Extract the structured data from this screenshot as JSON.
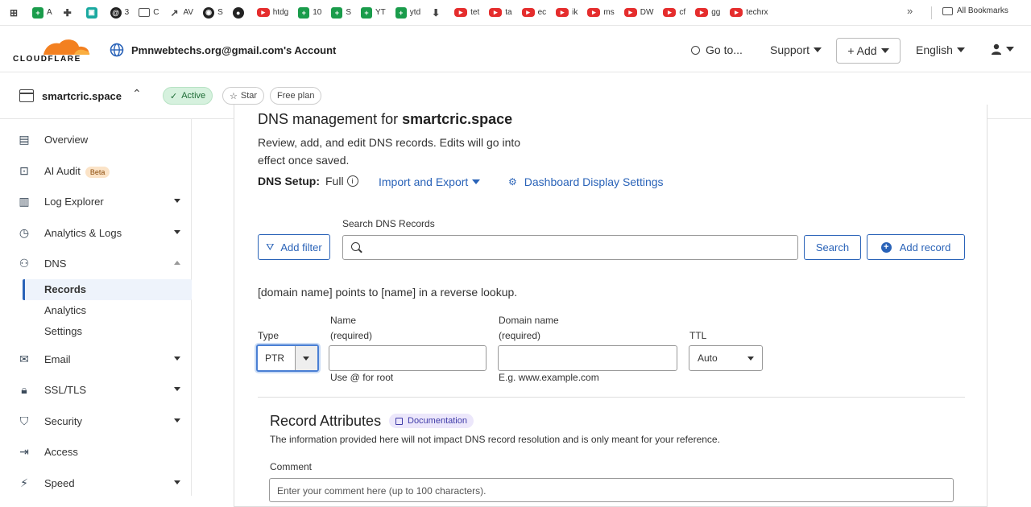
{
  "bookmarks": {
    "items": [
      {
        "label": "",
        "icon": "grid-icon"
      },
      {
        "label": "A",
        "icon": "sheets-icon"
      },
      {
        "label": "",
        "icon": "extension-icon"
      },
      {
        "label": "",
        "icon": "teal-square-icon"
      },
      {
        "label": "3",
        "icon": "threads-icon"
      },
      {
        "label": "C",
        "icon": "folder-icon"
      },
      {
        "label": "AV",
        "icon": "chart-icon"
      },
      {
        "label": "S",
        "icon": "chrome-icon"
      },
      {
        "label": "",
        "icon": "github-icon"
      },
      {
        "label": "htdg",
        "icon": "youtube-icon"
      },
      {
        "label": "10",
        "icon": "sheets-icon"
      },
      {
        "label": "S",
        "icon": "sheets-icon"
      },
      {
        "label": "YT",
        "icon": "sheets-icon"
      },
      {
        "label": "ytd",
        "icon": "sheets-icon"
      },
      {
        "label": "",
        "icon": "pin-icon"
      },
      {
        "label": "tet",
        "icon": "youtube-icon"
      },
      {
        "label": "ta",
        "icon": "youtube-icon"
      },
      {
        "label": "ec",
        "icon": "youtube-icon"
      },
      {
        "label": "ik",
        "icon": "youtube-icon"
      },
      {
        "label": "ms",
        "icon": "youtube-icon"
      },
      {
        "label": "DW",
        "icon": "youtube-icon"
      },
      {
        "label": "cf",
        "icon": "youtube-icon"
      },
      {
        "label": "gg",
        "icon": "youtube-icon"
      },
      {
        "label": "techrx",
        "icon": "youtube-icon"
      }
    ],
    "more": "»",
    "all_label": "All Bookmarks"
  },
  "header": {
    "logo_text": "CLOUDFLARE",
    "account": "Pmnwebtechs.org@gmail.com's Account",
    "goto": "Go to...",
    "support": "Support",
    "add": "+ Add",
    "language": "English"
  },
  "zone": {
    "name": "smartcric.space",
    "status": "Active",
    "star": "Star",
    "plan": "Free plan"
  },
  "sidebar": {
    "items": [
      {
        "label": "Overview",
        "icon": "document-icon"
      },
      {
        "label": "AI Audit",
        "icon": "robot-icon",
        "badge": "Beta"
      },
      {
        "label": "Log Explorer",
        "icon": "log-icon"
      },
      {
        "label": "Analytics & Logs",
        "icon": "clock-icon"
      },
      {
        "label": "DNS",
        "icon": "network-icon"
      },
      {
        "label": "Email",
        "icon": "email-icon"
      },
      {
        "label": "SSL/TLS",
        "icon": "lock-icon"
      },
      {
        "label": "Security",
        "icon": "shield-icon"
      },
      {
        "label": "Access",
        "icon": "access-icon"
      },
      {
        "label": "Speed",
        "icon": "bolt-icon"
      }
    ],
    "dns_sub": [
      "Records",
      "Analytics",
      "Settings"
    ]
  },
  "main": {
    "title_prefix": "DNS management for",
    "title_zone": "smartcric.space",
    "description": "Review, add, and edit DNS records. Edits will go into effect once saved.",
    "setup_label": "DNS Setup:",
    "setup_value": "Full",
    "import_export": "Import and Export",
    "dashboard_settings": "Dashboard Display Settings",
    "search_label": "Search DNS Records",
    "add_filter": "Add filter",
    "search_btn": "Search",
    "add_record": "Add record",
    "ptr_note": "[domain name] points to [name] in a reverse lookup.",
    "type_label": "Type",
    "type_value": "PTR",
    "name_label": "Name",
    "name_req": "(required)",
    "name_hint": "Use @ for root",
    "domain_label": "Domain name",
    "domain_req": "(required)",
    "domain_hint": "E.g. www.example.com",
    "ttl_label": "TTL",
    "ttl_value": "Auto",
    "attr_title": "Record Attributes",
    "doc_label": "Documentation",
    "attr_desc": "The information provided here will not impact DNS record resolution and is only meant for your reference.",
    "comment_label": "Comment",
    "comment_placeholder": "Enter your comment here (up to 100 characters)."
  },
  "colors": {
    "accent": "#2a63b8",
    "brand_orange": "#f38020",
    "active_green": "#d6f1de"
  }
}
